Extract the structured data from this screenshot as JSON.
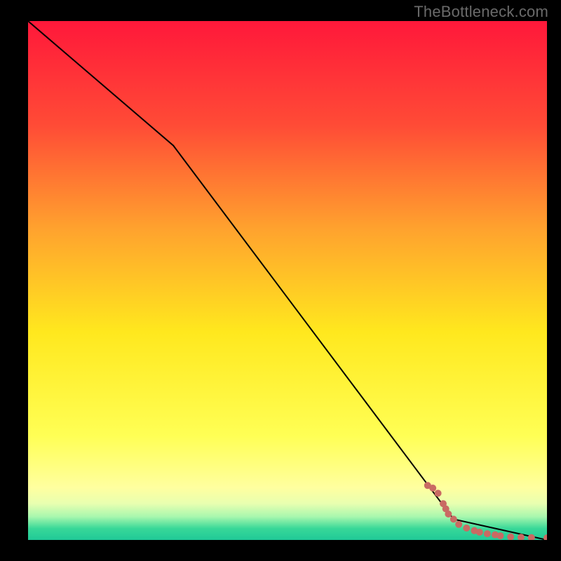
{
  "watermark": "TheBottleneck.com",
  "chart_data": {
    "type": "line",
    "title": "",
    "xlabel": "",
    "ylabel": "",
    "xlim": [
      0,
      100
    ],
    "ylim": [
      0,
      100
    ],
    "line": {
      "x": [
        0,
        28,
        82,
        100
      ],
      "y": [
        100,
        76,
        4,
        0
      ]
    },
    "markers": {
      "x": [
        77,
        78,
        79,
        80,
        80.5,
        81,
        82,
        83,
        84.5,
        86,
        87,
        88.5,
        90,
        91,
        93,
        95,
        97,
        100
      ],
      "y": [
        10.5,
        10,
        9,
        7,
        6,
        5,
        4,
        3,
        2.3,
        1.8,
        1.5,
        1.2,
        1,
        0.8,
        0.6,
        0.5,
        0.45,
        0.4
      ],
      "color": "#c96a63",
      "radius": 5
    },
    "background_gradient": [
      {
        "pos": 0,
        "color": "#ff183a"
      },
      {
        "pos": 0.2,
        "color": "#ff4b36"
      },
      {
        "pos": 0.4,
        "color": "#ffa22e"
      },
      {
        "pos": 0.6,
        "color": "#ffe81e"
      },
      {
        "pos": 0.8,
        "color": "#ffff55"
      },
      {
        "pos": 0.9,
        "color": "#ffffa0"
      },
      {
        "pos": 0.93,
        "color": "#e8ffb0"
      },
      {
        "pos": 0.955,
        "color": "#a8f7ae"
      },
      {
        "pos": 0.978,
        "color": "#38d898"
      },
      {
        "pos": 1.0,
        "color": "#20c997"
      }
    ]
  }
}
